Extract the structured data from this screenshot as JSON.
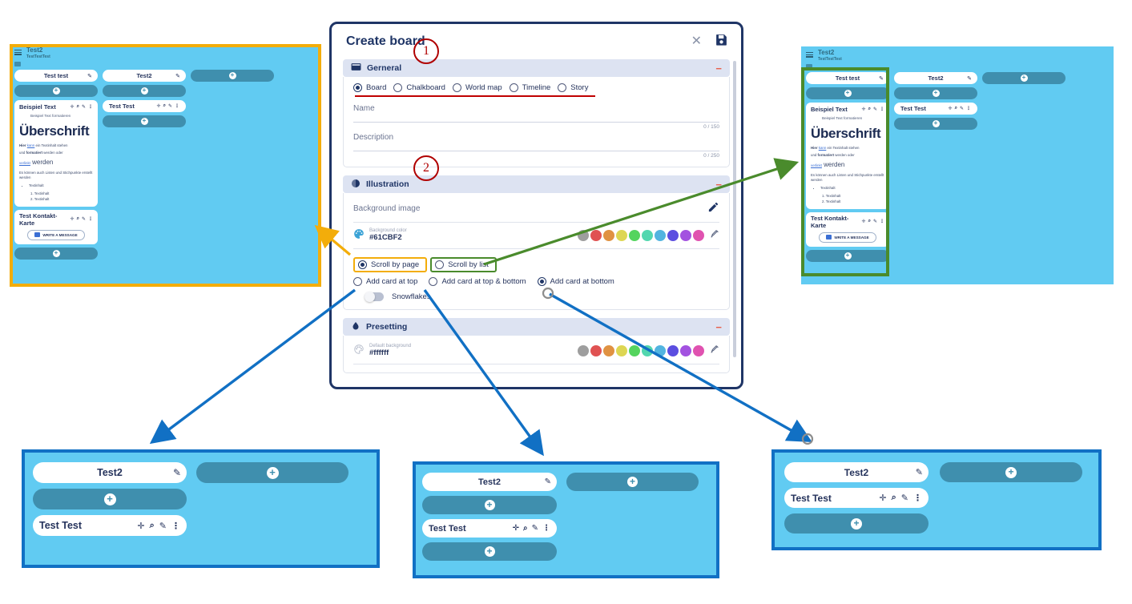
{
  "dialog": {
    "title": "Create board",
    "close_icon": "close-icon",
    "save_icon": "save-icon",
    "sections": {
      "general": {
        "title": "Gerneral",
        "icon": "board-icon",
        "collapse": "−",
        "board_types": [
          {
            "label": "Board",
            "selected": true
          },
          {
            "label": "Chalkboard",
            "selected": false
          },
          {
            "label": "World map",
            "selected": false
          },
          {
            "label": "Timeline",
            "selected": false
          },
          {
            "label": "Story",
            "selected": false
          }
        ],
        "name_label": "Name",
        "name_value": "",
        "name_counter": "0 / 150",
        "description_label": "Description",
        "description_value": "",
        "description_counter": "0 / 250"
      },
      "illustration": {
        "title": "Illustration",
        "icon": "globe-icon",
        "collapse": "−",
        "background_image_label": "Background image",
        "edit_icon": "pencil-icon",
        "background_color_label": "Background color",
        "background_color_value": "#61CBF2",
        "palette_icon": "palette-icon",
        "dropper_icon": "eyedropper-icon",
        "swatches": [
          "#9e9e9e",
          "#e05252",
          "#e09242",
          "#ddd653",
          "#54d45e",
          "#53d7af",
          "#52b4e0",
          "#5b4ee0",
          "#a352e0",
          "#e052b0"
        ],
        "scroll_options": [
          {
            "label": "Scroll by page",
            "selected": true
          },
          {
            "label": "Scroll by list",
            "selected": false
          }
        ],
        "add_card_options": [
          {
            "label": "Add card at top",
            "selected": false
          },
          {
            "label": "Add card at top & bottom",
            "selected": false
          },
          {
            "label": "Add card at bottom",
            "selected": true
          }
        ],
        "snowflakes_label": "Snowflakes",
        "snowflakes_on": false
      },
      "presetting": {
        "title": "Presetting",
        "icon": "droplet-icon",
        "collapse": "−",
        "default_background_label": "Default background",
        "default_background_value": "#ffffff",
        "palette_icon": "palette-icon",
        "dropper_icon": "eyedropper-icon",
        "swatches": [
          "#9e9e9e",
          "#e05252",
          "#e09242",
          "#ddd653",
          "#54d45e",
          "#53d7af",
          "#52b4e0",
          "#5b4ee0",
          "#a352e0",
          "#e052b0"
        ]
      }
    }
  },
  "annotations": {
    "markers": [
      {
        "label": "1",
        "color": "#b00000"
      },
      {
        "label": "2",
        "color": "#b00000"
      }
    ],
    "highlight_colors": {
      "yellow": "#f3ad0a",
      "green": "#4a8b2c",
      "blue": "#1170c4",
      "red": "#b00000"
    }
  },
  "boards": {
    "header": {
      "title": "Test2",
      "subtitle": "TestTestTest",
      "menu_icon": "hamburger-icon"
    },
    "labels": {
      "list_test_test": "Test test",
      "list_test2": "Test2",
      "card_beispiel": "Beispiel Text",
      "card_test_test": "Test Test",
      "card_kontakt": "Test Kontakt-Karte",
      "write_message": "WRITE A MESSAGE",
      "edit_icon": "pencil-icon",
      "add_icon": "plus-icon",
      "move_icon": "move-icon",
      "zoom_icon": "magnifier-icon",
      "menu_icon": "more-vertical-icon"
    },
    "text_card": {
      "note": "Beispiel Text formatieren",
      "heading": "Überschrift",
      "line1_bold": "Hier",
      "line1_link": "kann",
      "line1_rest": " ein Textinhalt stehen",
      "line2_pre": "und ",
      "line2_bold": "formatiert",
      "line2_rest": " werden oder",
      "line3_link": "verlinkt",
      "line3_rest": " werden",
      "line4": "Es können auch Listen und Stichpunkte erstellt werden",
      "bullet": "Textinhalt",
      "num1": "1. Textinhalt",
      "num2": "2. Textinhalt"
    },
    "top_left": {
      "name": "board-scroll-by-page-preview"
    },
    "top_right": {
      "name": "board-scroll-by-list-preview"
    },
    "bottom_left": {
      "name": "board-add-card-at-top-preview"
    },
    "bottom_center": {
      "name": "board-add-card-top-bottom-preview"
    },
    "bottom_right": {
      "name": "board-add-card-at-bottom-preview"
    }
  }
}
